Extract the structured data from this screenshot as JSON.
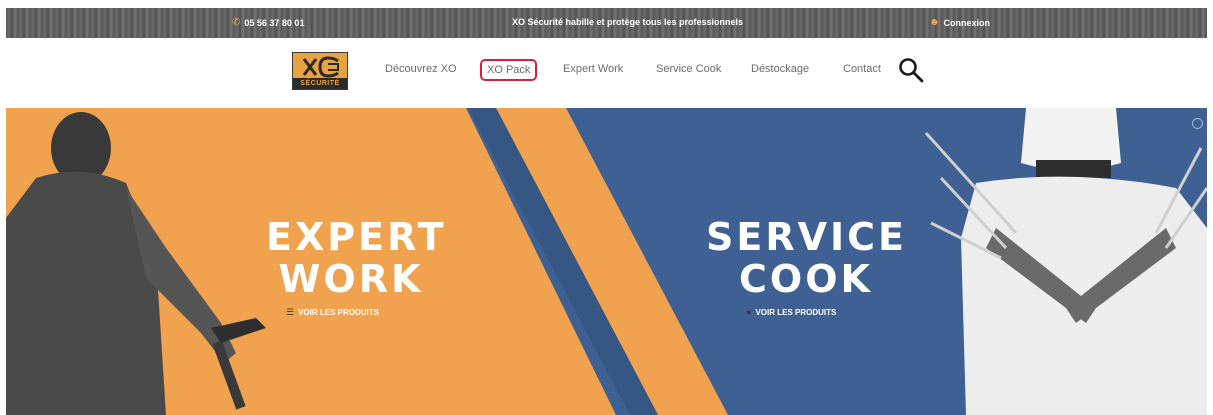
{
  "topbar": {
    "phone": "05 56 37 80 01",
    "tagline": "XO Sécurité habille et protège tous les professionnels",
    "login": "Connexion",
    "phone_icon": "phone-icon",
    "user_icon": "user-icon"
  },
  "nav": {
    "logo_text": "SÉCURITÉ",
    "items": [
      {
        "label": "Découvrez XO"
      },
      {
        "label": "XO Pack"
      },
      {
        "label": "Expert Work"
      },
      {
        "label": "Service Cook"
      },
      {
        "label": "Déstockage"
      },
      {
        "label": "Contact"
      }
    ],
    "active_index": 1,
    "search_icon": "search-icon"
  },
  "hero": {
    "left": {
      "title_line1": "EXPERT",
      "title_line2": "WORK",
      "link": "VOIR LES PRODUITS"
    },
    "right": {
      "title_line1": "SERVICE",
      "title_line2": "COOK",
      "link": "VOIR LES PRODUITS"
    }
  },
  "colors": {
    "orange": "#f0a24e",
    "blue": "#3f6092",
    "accent_red": "#d1243a",
    "logo_orange": "#e8a23f"
  }
}
